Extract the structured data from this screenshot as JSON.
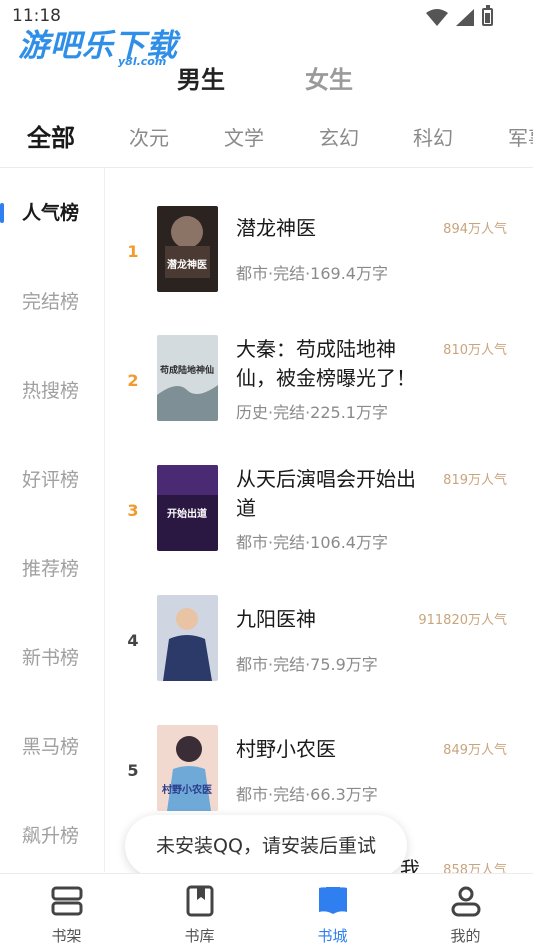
{
  "status_bar": {
    "time": "11:18",
    "icons": [
      "wifi-icon",
      "signal-icon",
      "battery-icon"
    ]
  },
  "watermark": {
    "main": "游吧乐下载",
    "sub": "y8l.com"
  },
  "gender_tabs": [
    {
      "label": "男生",
      "active": true
    },
    {
      "label": "女生",
      "active": false
    }
  ],
  "category_tabs": [
    {
      "label": "全部",
      "active": true
    },
    {
      "label": "次元"
    },
    {
      "label": "文学"
    },
    {
      "label": "玄幻"
    },
    {
      "label": "科幻"
    },
    {
      "label": "军事"
    }
  ],
  "sidebar": {
    "items": [
      {
        "label": "人气榜",
        "active": true
      },
      {
        "label": "完结榜"
      },
      {
        "label": "热搜榜"
      },
      {
        "label": "好评榜"
      },
      {
        "label": "推荐榜"
      },
      {
        "label": "新书榜"
      },
      {
        "label": "黑马榜"
      },
      {
        "label": "飙升榜"
      }
    ]
  },
  "books": [
    {
      "rank": "1",
      "title": "潜龙神医",
      "meta": "都市·完结·169.4万字",
      "popularity": "894万人气",
      "cover_text": "潜龙神医",
      "cover_color": "#3a2a22"
    },
    {
      "rank": "2",
      "title": "大秦：苟成陆地神仙，被金榜曝光了！",
      "meta": "历史·完结·225.1万字",
      "popularity": "810万人气",
      "cover_text": "苟成陆地神仙",
      "cover_color": "#c9d3d8"
    },
    {
      "rank": "3",
      "title": "从天后演唱会开始出道",
      "meta": "都市·完结·106.4万字",
      "popularity": "819万人气",
      "cover_text": "开始出道",
      "cover_color": "#3a1c5a"
    },
    {
      "rank": "4",
      "title": "九阳医神",
      "meta": "都市·完结·75.9万字",
      "popularity": "911820万人气",
      "cover_text": "",
      "cover_color": "#2c3a6a"
    },
    {
      "rank": "5",
      "title": "村野小农医",
      "meta": "都市·完结·66.3万字",
      "popularity": "849万人气",
      "cover_text": "村野小农医",
      "cover_color": "#e7b7a4"
    },
    {
      "rank": "",
      "title": "我",
      "meta": "",
      "popularity": "858万人气",
      "cover_text": "",
      "cover_color": "#ffffff"
    }
  ],
  "toast": {
    "text": "未安装QQ，请安装后重试"
  },
  "bottom_nav": [
    {
      "label": "书架",
      "icon": "bookshelf-icon",
      "active": false
    },
    {
      "label": "书库",
      "icon": "library-icon",
      "active": false
    },
    {
      "label": "书城",
      "icon": "bookstore-icon",
      "active": true
    },
    {
      "label": "我的",
      "icon": "profile-icon",
      "active": false
    }
  ],
  "colors": {
    "accent": "#2f7ff0",
    "rank_top": "#f39a2b",
    "popularity": "#c9a57d"
  }
}
